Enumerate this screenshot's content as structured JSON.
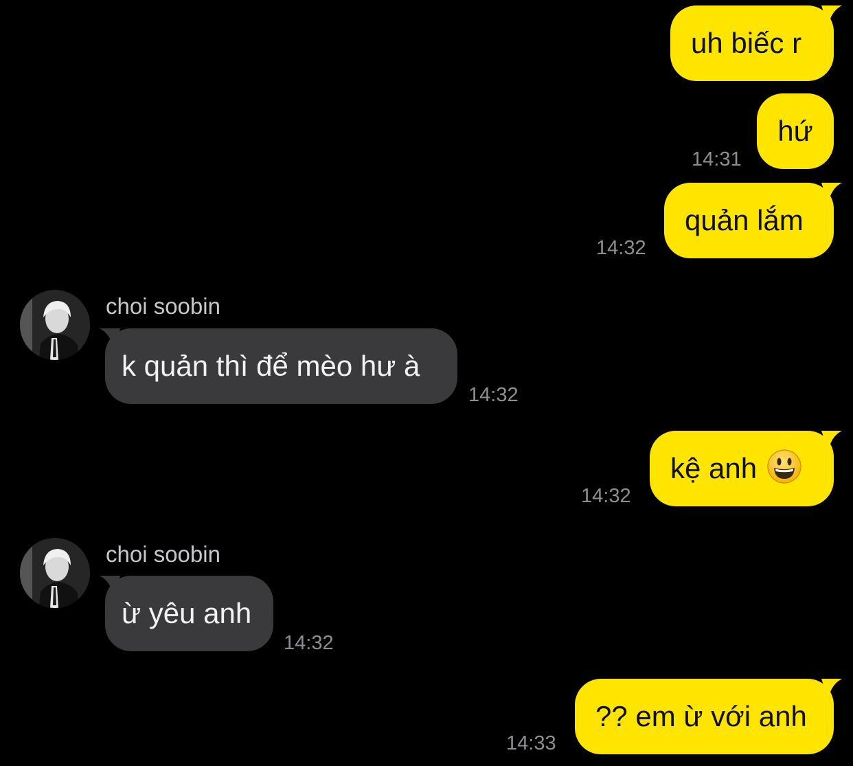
{
  "messages": [
    {
      "side": "out",
      "text": "uh biếc r"
    },
    {
      "side": "out",
      "text": "hứ",
      "time": "14:31"
    },
    {
      "side": "out",
      "text": "quản lắm",
      "time": "14:32"
    },
    {
      "side": "in",
      "sender": "choi soobin",
      "text": "k quản thì để mèo hư à",
      "time": "14:32"
    },
    {
      "side": "out",
      "text": "kệ anh",
      "emoji": "grinning-face-emoji",
      "time": "14:32"
    },
    {
      "side": "in",
      "sender": "choi soobin",
      "text": "ừ yêu anh",
      "time": "14:32"
    },
    {
      "side": "out",
      "text": "?? em ừ với anh",
      "time": "14:33"
    }
  ],
  "colors": {
    "background": "#000000",
    "outgoing_bubble": "#FEE500",
    "incoming_bubble": "#3a3a3c",
    "timestamp": "#8e8e93"
  },
  "icons": {
    "avatar": "avatar",
    "emoji": "grinning-face-emoji"
  }
}
